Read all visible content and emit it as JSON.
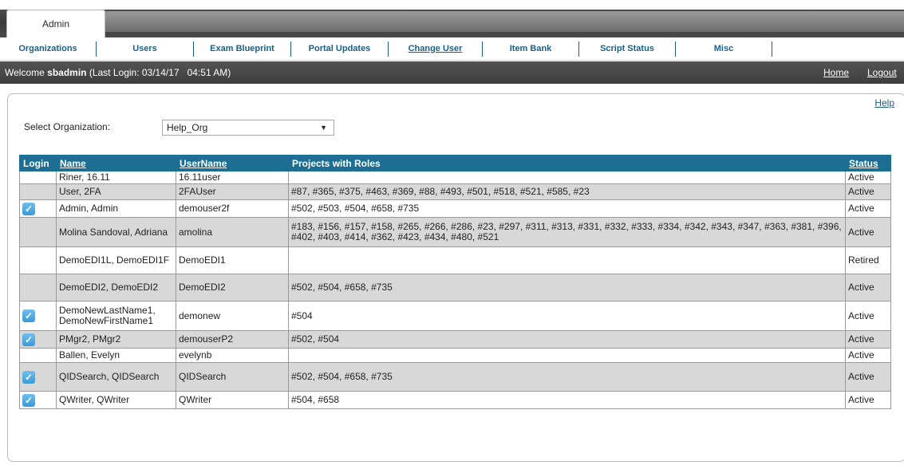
{
  "tabs": {
    "active": "Admin"
  },
  "nav": [
    {
      "label": "Organizations",
      "underline": false
    },
    {
      "label": "Users",
      "underline": false
    },
    {
      "label": "Exam Blueprint",
      "underline": false
    },
    {
      "label": "Portal Updates",
      "underline": false
    },
    {
      "label": "Change User",
      "underline": true
    },
    {
      "label": "Item Bank",
      "underline": false
    },
    {
      "label": "Script Status",
      "underline": false
    },
    {
      "label": "Misc",
      "underline": false
    }
  ],
  "welcome": {
    "prefix": "Welcome",
    "username": "sbadmin",
    "last_login": "(Last Login: 03/14/17   04:51 AM)",
    "home": "Home",
    "logout": "Logout"
  },
  "help": "Help",
  "org": {
    "label": "Select Organization:",
    "selected": "Help_Org"
  },
  "table": {
    "headers": {
      "login": "Login",
      "name": "Name",
      "username": "UserName",
      "projects": "Projects with Roles",
      "status": "Status"
    },
    "rows": [
      {
        "login": false,
        "name": "Riner, 16.11",
        "username": "16.11user",
        "projects": "",
        "status": "Active"
      },
      {
        "login": false,
        "name": "User, 2FA",
        "username": "2FAUser",
        "projects": "#87, #365, #375, #463, #369, #88, #493, #501, #518, #521, #585, #23",
        "status": "Active"
      },
      {
        "login": true,
        "name": "Admin, Admin",
        "username": "demouser2f",
        "projects": "#502, #503, #504, #658, #735",
        "status": "Active"
      },
      {
        "login": false,
        "name": "Molina Sandoval, Adriana",
        "username": "amolina",
        "projects": "#183, #156, #157, #158, #265, #266, #286, #23, #297, #311, #313, #331, #332, #333, #334, #342, #343, #347, #363, #381, #396, #402, #403, #414, #362, #423, #434, #480, #521",
        "status": "Active"
      },
      {
        "login": false,
        "name": "DemoEDI1L, DemoEDI1F",
        "username": "DemoEDI1",
        "projects": "",
        "status": "Retired"
      },
      {
        "login": false,
        "name": "DemoEDI2, DemoEDI2",
        "username": "DemoEDI2",
        "projects": "#502, #504, #658, #735",
        "status": "Active"
      },
      {
        "login": true,
        "name": "DemoNewLastName1, DemoNewFirstName1",
        "username": "demonew",
        "projects": "#504",
        "status": "Active"
      },
      {
        "login": true,
        "name": "PMgr2, PMgr2",
        "username": "demouserP2",
        "projects": "#502, #504",
        "status": "Active"
      },
      {
        "login": false,
        "name": "Ballen, Evelyn",
        "username": "evelynb",
        "projects": "",
        "status": "Active"
      },
      {
        "login": true,
        "name": "QIDSearch, QIDSearch",
        "username": "QIDSearch",
        "projects": "#502, #504, #658, #735",
        "status": "Active"
      },
      {
        "login": true,
        "name": "QWriter, QWriter",
        "username": "QWriter",
        "projects": "#504, #658",
        "status": "Active"
      }
    ]
  }
}
